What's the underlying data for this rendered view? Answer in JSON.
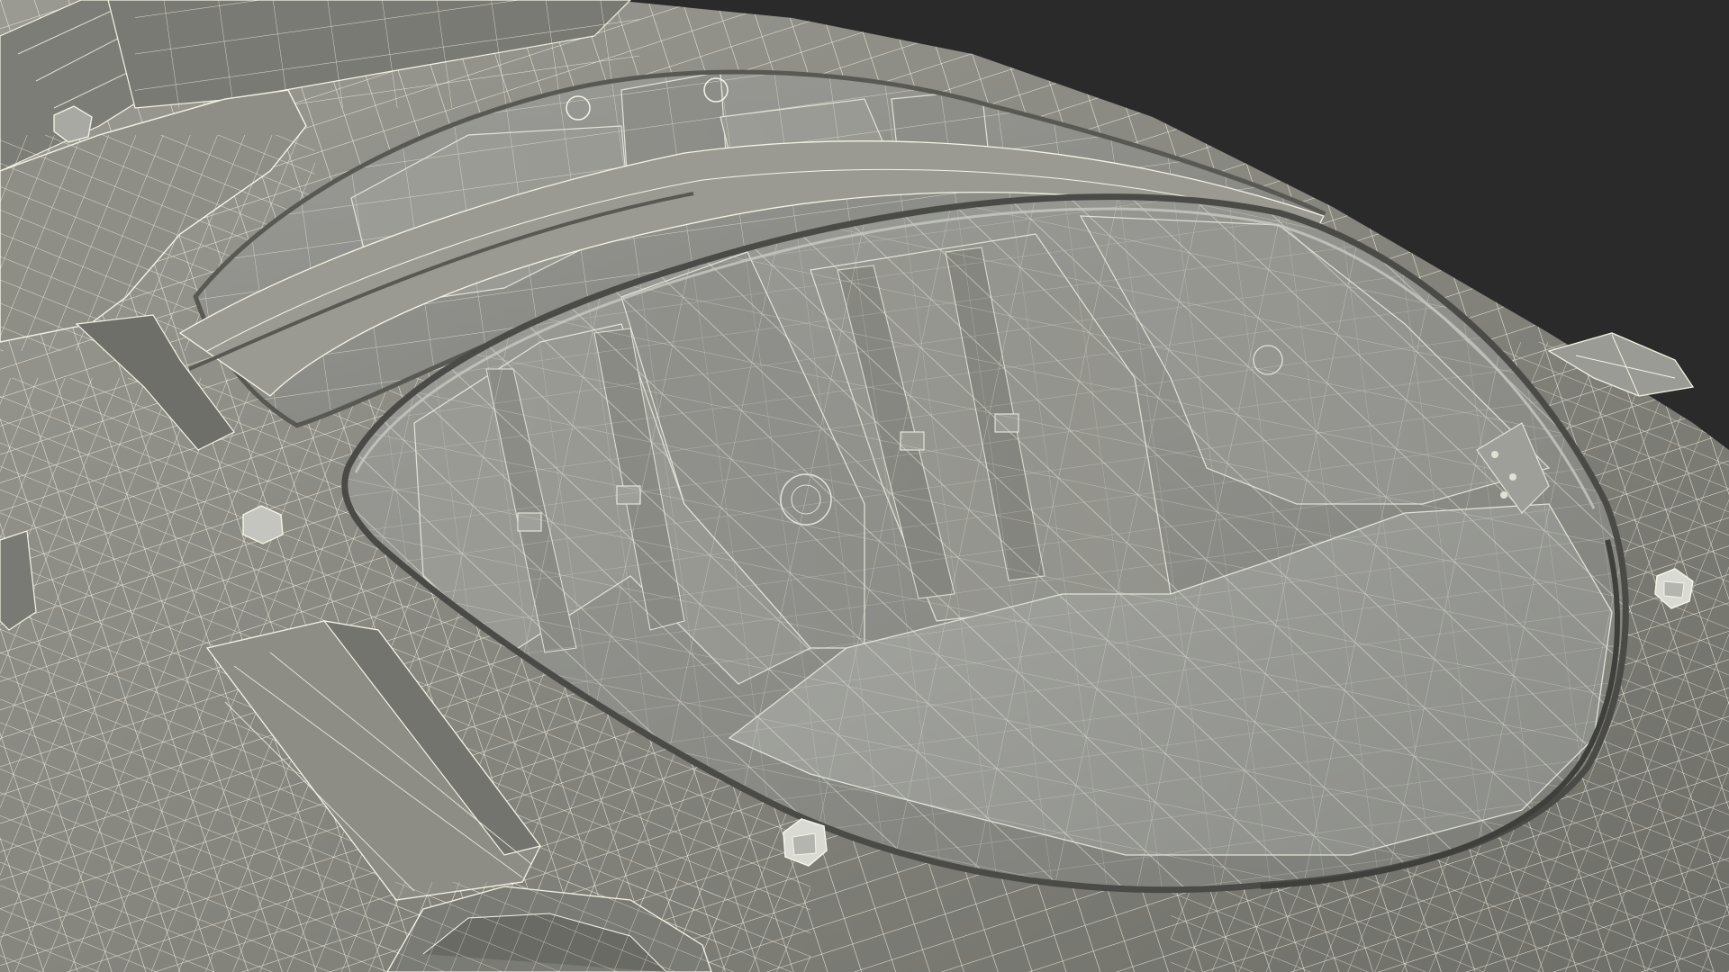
{
  "scene": {
    "background_color": "#2a2a2a",
    "hull_color": "#8f8f88",
    "wire_color": "#f4f4e6",
    "interior_color": "#7b7b76",
    "glass_color": "#b9bcb6"
  }
}
